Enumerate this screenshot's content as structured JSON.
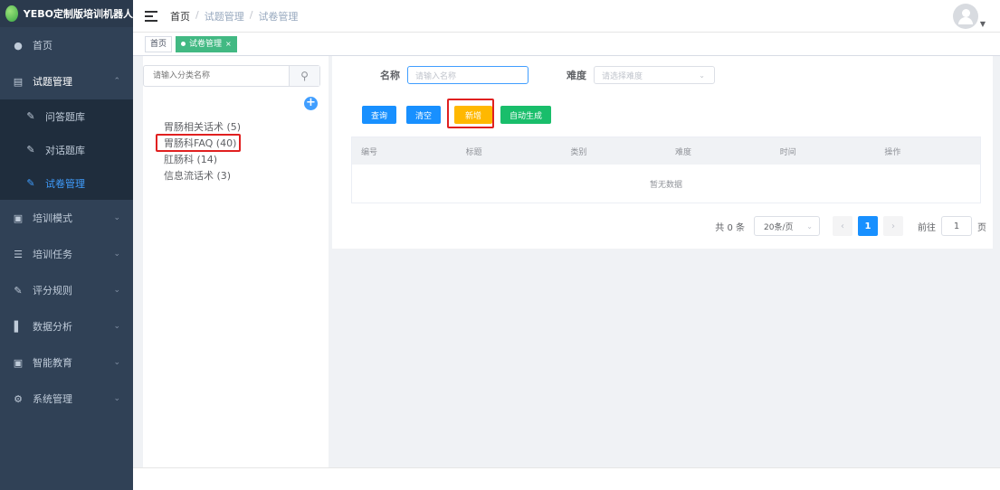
{
  "app": {
    "logo_text": "YEBO定制版培训机器人"
  },
  "sidebar": {
    "items": [
      {
        "label": "首页",
        "icon": "dashboard-icon"
      },
      {
        "label": "试题管理",
        "icon": "book-icon",
        "expanded": true
      },
      {
        "label": "问答题库",
        "icon": "edit-icon"
      },
      {
        "label": "对话题库",
        "icon": "edit-icon"
      },
      {
        "label": "试卷管理",
        "icon": "edit-icon",
        "active": true
      },
      {
        "label": "培训模式",
        "icon": "monitor-icon"
      },
      {
        "label": "培训任务",
        "icon": "list-icon"
      },
      {
        "label": "评分规则",
        "icon": "edit-icon"
      },
      {
        "label": "数据分析",
        "icon": "bar-chart-icon"
      },
      {
        "label": "智能教育",
        "icon": "screen-icon"
      },
      {
        "label": "系统管理",
        "icon": "gear-icon"
      }
    ]
  },
  "header": {
    "breadcrumb": [
      "首页",
      "试题管理",
      "试卷管理"
    ],
    "sep": "/"
  },
  "tags": {
    "home": "首页",
    "active": "试卷管理"
  },
  "tree": {
    "search_placeholder": "请输入分类名称",
    "nodes": [
      "胃肠相关话术 (5)",
      "胃肠科FAQ (40)",
      "肛肠科 (14)",
      "信息流话术 (3)"
    ]
  },
  "form": {
    "name_label": "名称",
    "name_placeholder": "请输入名称",
    "difficulty_label": "难度",
    "difficulty_placeholder": "请选择难度"
  },
  "buttons": {
    "query": "查询",
    "clear": "清空",
    "add": "新增",
    "auto": "自动生成"
  },
  "table": {
    "headers": [
      "编号",
      "标题",
      "类别",
      "难度",
      "时间",
      "操作"
    ],
    "empty_text": "暂无数据"
  },
  "pagination": {
    "total": "共 0 条",
    "page_size": "20条/页",
    "current": "1",
    "goto_label": "前往",
    "goto_value": "1",
    "page_suffix": "页"
  },
  "colors": {
    "sidebar_bg": "#304156",
    "accent": "#409eff",
    "tag_active": "#42b983",
    "add_button": "#ffb800",
    "auto_button": "#19be6b",
    "highlight": "#e02020"
  }
}
